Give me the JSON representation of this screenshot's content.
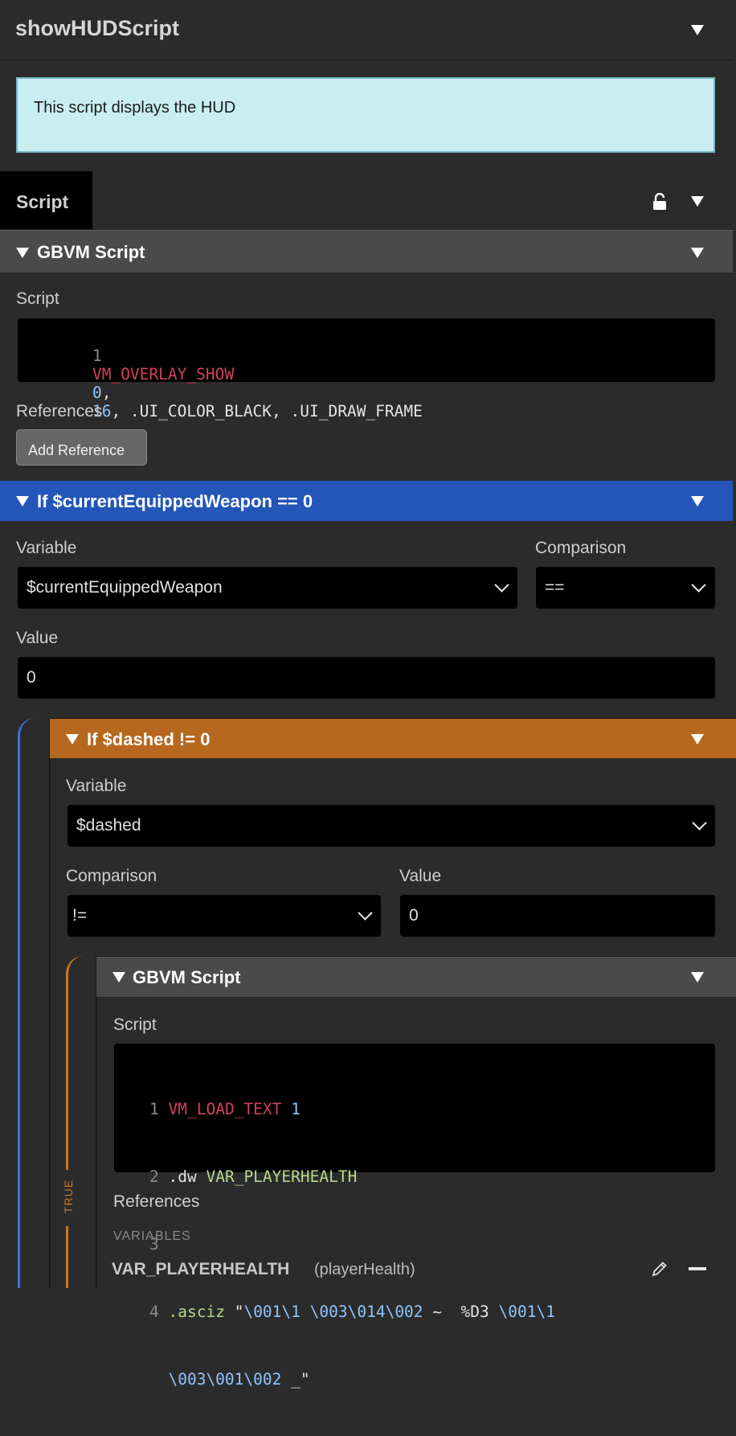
{
  "header": {
    "title": "showHUDScript"
  },
  "description": "This script displays the HUD",
  "tab": {
    "label": "Script"
  },
  "gbvm1": {
    "title": "GBVM Script",
    "script_label": "Script",
    "line1": {
      "num": "1",
      "cmd": "VM_OVERLAY_SHOW",
      "a": "0",
      "c1": ",",
      "b": "16",
      "rest": ", .UI_COLOR_BLACK, .UI_DRAW_FRAME"
    },
    "references_label": "References",
    "add_reference": "Add Reference"
  },
  "if1": {
    "title": "If $currentEquippedWeapon == 0",
    "variable_label": "Variable",
    "variable_value": "$currentEquippedWeapon",
    "comparison_label": "Comparison",
    "comparison_value": "==",
    "value_label": "Value",
    "value": "0"
  },
  "if2": {
    "title": "If $dashed != 0",
    "variable_label": "Variable",
    "variable_value": "$dashed",
    "comparison_label": "Comparison",
    "comparison_value": "!=",
    "value_label": "Value",
    "value": "0"
  },
  "gbvm2": {
    "title": "GBVM Script",
    "script_label": "Script",
    "l1": {
      "num": "1",
      "cmd": "VM_LOAD_TEXT",
      "arg": "1"
    },
    "l2": {
      "num": "2",
      "dir": ".dw",
      "arg": "VAR_PLAYERHEALTH"
    },
    "l3": {
      "num": "3"
    },
    "l4": {
      "num": "4",
      "dir": ".asciz",
      "q": "\"",
      "e1": "\\001\\1",
      "e2": "\\003\\014\\002",
      "t1": "~  %D3",
      "e3": "\\001\\1",
      "e4": "\\003\\001\\002",
      "t2": "_\""
    },
    "references_label": "References",
    "variables_label": "VARIABLES",
    "ref_var": "VAR_PLAYERHEALTH",
    "ref_alias": "(playerHealth)"
  },
  "true_label": "TRUE",
  "colors": {
    "blue_header": "#2356b8",
    "orange_header": "#b5681e",
    "description_bg": "#c8eef2"
  }
}
